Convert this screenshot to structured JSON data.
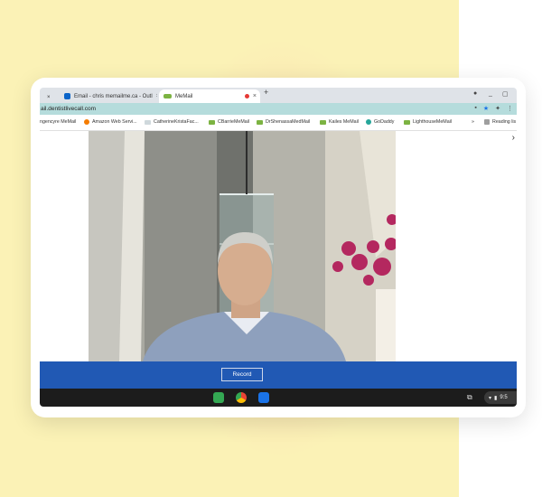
{
  "tabs": [
    {
      "label": "Email - chris memailme.ca - Outl",
      "icon": "outlook-icon"
    },
    {
      "label": "MeMail",
      "icon": "memail-icon",
      "recording": true
    }
  ],
  "address": {
    "url": "ail.dentistlivecall.com"
  },
  "bookmarks": [
    {
      "label": "ngencyre MeMail"
    },
    {
      "label": "Amazon Web Servi..."
    },
    {
      "label": "CatherineKristaFac..."
    },
    {
      "label": "CBarrieMeMail"
    },
    {
      "label": "DrShenassaMedMail"
    },
    {
      "label": "Kailes MeMail"
    },
    {
      "label": "GoDaddy"
    },
    {
      "label": "LighthouseMeMail"
    },
    {
      "label": "»"
    },
    {
      "label": "Reading lis"
    }
  ],
  "video": {
    "description": "webcam preview"
  },
  "record": {
    "label": "Record"
  },
  "shelf": {
    "time": "9:5"
  },
  "colors": {
    "background_yellow": "#fbf2b6",
    "address_bar": "#b5dcdc",
    "record_bar": "#2159b4",
    "shelf": "#1c1c1c"
  }
}
